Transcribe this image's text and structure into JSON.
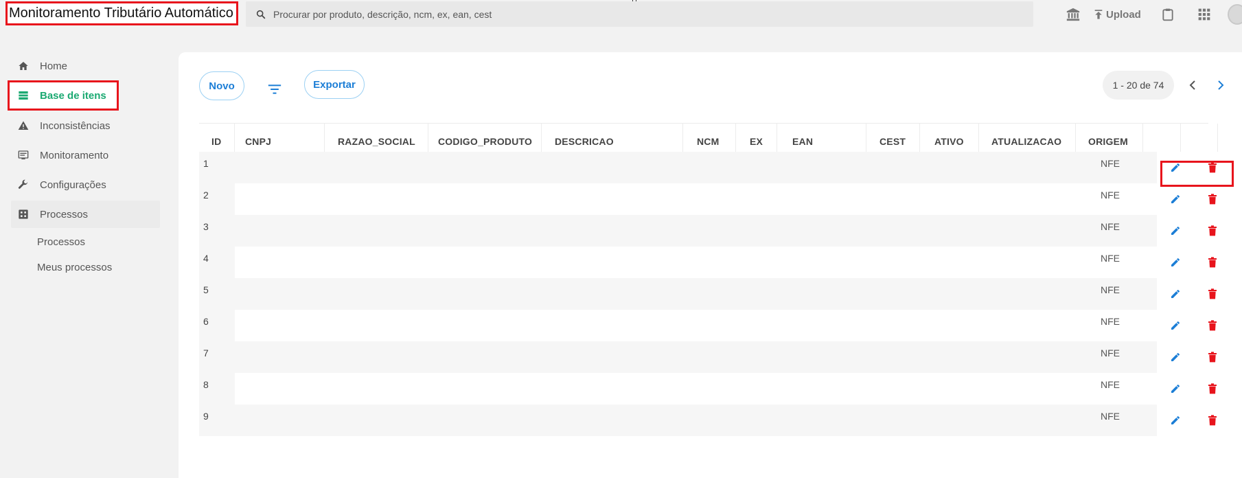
{
  "app": {
    "title": "Monitoramento Tributário Automático"
  },
  "search": {
    "placeholder": "Procurar por produto, descrição, ncm, ex, ean, cest",
    "value": ""
  },
  "topbar": {
    "upload_label": "Upload",
    "icons": [
      "bank-icon",
      "upload-icon",
      "clipboard-icon",
      "apps-grid-icon",
      "avatar"
    ]
  },
  "sidebar": {
    "items": [
      {
        "label": "Home",
        "icon": "home-icon"
      },
      {
        "label": "Base de itens",
        "icon": "database-icon",
        "active": true
      },
      {
        "label": "Inconsistências",
        "icon": "warning-icon"
      },
      {
        "label": "Monitoramento",
        "icon": "monitor-list-icon"
      },
      {
        "label": "Configurações",
        "icon": "wrench-icon"
      },
      {
        "label": "Processos",
        "icon": "processes-icon",
        "expanded": true
      }
    ],
    "subitems": [
      {
        "label": "Processos"
      },
      {
        "label": "Meus processos"
      }
    ]
  },
  "toolbar": {
    "new_label": "Novo",
    "export_label": "Exportar"
  },
  "pagination": {
    "label": "1 - 20 de 74"
  },
  "table": {
    "columns": [
      "ID",
      "CNPJ",
      "RAZAO_SOCIAL",
      "CODIGO_PRODUTO",
      "DESCRICAO",
      "NCM",
      "EX",
      "EAN",
      "CEST",
      "ATIVO",
      "ATUALIZACAO",
      "ORIGEM"
    ],
    "rows": [
      {
        "id": "1",
        "origem": "NFE"
      },
      {
        "id": "2",
        "origem": "NFE"
      },
      {
        "id": "3",
        "origem": "NFE"
      },
      {
        "id": "4",
        "origem": "NFE"
      },
      {
        "id": "5",
        "origem": "NFE"
      },
      {
        "id": "6",
        "origem": "NFE"
      },
      {
        "id": "7",
        "origem": "NFE"
      },
      {
        "id": "8",
        "origem": "NFE"
      },
      {
        "id": "9",
        "origem": "NFE"
      }
    ]
  },
  "colors": {
    "accent_green": "#1aa971",
    "accent_blue": "#1c7ed6",
    "delete_red": "#e8141c",
    "highlight_red": "#e8141c"
  }
}
